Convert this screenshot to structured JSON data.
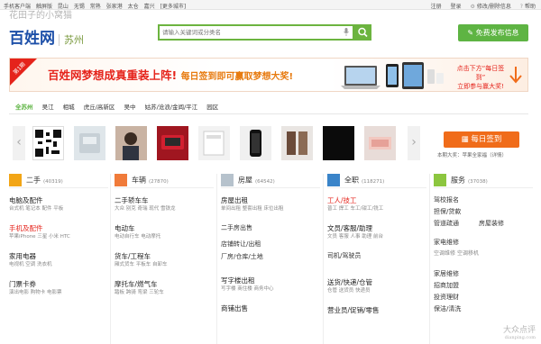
{
  "topbar": {
    "left": [
      "手机客户端",
      "触屏版",
      "昆山",
      "无锡",
      "常熟",
      "张家港",
      "太仓",
      "嘉兴",
      "[更多城市]"
    ],
    "right": [
      "注册",
      "登录",
      "修改/删除信息",
      "帮助"
    ]
  },
  "watermark_top": "花田子的小窝猫",
  "header": {
    "logo": "百姓网",
    "city": "苏州",
    "search_placeholder": "请输入关键词或分类名",
    "post_button": "免费发布信息"
  },
  "banner": {
    "badge": "第1期",
    "title": "百姓网梦想成真重装上阵!",
    "subtitle": "每日签到即可赢取梦想大奖!",
    "right_line1": "点击下方“每日签到”",
    "right_line2": "立即参与赢大奖!"
  },
  "districts": [
    "全苏州",
    "吴江",
    "相城",
    "虎丘/高新区",
    "吴中",
    "姑苏/沧浪/金阊/平江",
    "园区"
  ],
  "signin": {
    "button": "每日签到",
    "note": "本期大奖：苹果全家福（详情）"
  },
  "categories": [
    {
      "name": "二手",
      "count": "(40319)",
      "color": "#f2a516",
      "items": [
        {
          "title": "电脑及配件",
          "sub": "台式机 笔记本 配件 平板",
          "hl": false
        },
        {
          "title": "手机及配件",
          "sub": "苹果iPhone 三星 小米 HTC",
          "hl": true
        },
        {
          "title": "家用电器",
          "sub": "电视机 空调 洗衣机",
          "hl": false
        },
        {
          "title": "门票卡券",
          "sub": "演出电影 购物卡 电影票",
          "hl": false
        }
      ]
    },
    {
      "name": "车辆",
      "count": "(27870)",
      "color": "#f07b3a",
      "items": [
        {
          "title": "二手轿车车",
          "sub": "大众 别克 奇瑞 现代 雪铁龙",
          "hl": false
        },
        {
          "title": "电动车",
          "sub": "电动自行车 电动摩托",
          "hl": false
        },
        {
          "title": "货车/工程车",
          "sub": "厢式货车 平板车 自卸车",
          "hl": false
        },
        {
          "title": "摩托车/燃气车",
          "sub": "踏板 跨骑 弯梁 三轮车",
          "hl": false
        }
      ]
    },
    {
      "name": "房屋",
      "count": "(64542)",
      "color": "#b6c2cc",
      "items": [
        "房屋出租",
        "单间出租 整套出租 床位出租",
        "二手房出售",
        "店铺转让/出租",
        "厂房/仓库/土地",
        "写字楼出租",
        "写字楼 商住楼 商务中心",
        "商铺出售"
      ]
    },
    {
      "name": "全职",
      "count": "(118271)",
      "color": "#3a84c9",
      "items": [
        "工人/技工",
        "普工 焊工 车工/钳工/铣工",
        "文员/客服/助理",
        "文员 客服 人事 助理 前台",
        "司机/驾驶员",
        "送货/快递/仓管",
        "仓管 送货员 快递员",
        "营业员/促销/零售"
      ]
    },
    {
      "name": "服务",
      "count": "(37038)",
      "color": "#8cc63f",
      "items": [
        "驾校报名",
        "担保/贷款",
        "管道疏通",
        "房屋装修",
        "家电维修",
        "空调维修",
        "空调移机",
        "家居维修",
        "招商加盟",
        "投资理财",
        "保洁/清洗"
      ]
    }
  ],
  "watermark_bottom": {
    "title": "大众点评",
    "url": "dianping.com"
  },
  "colors": {
    "green": "#5eb443",
    "orange": "#f06c1a",
    "red": "#e5231b",
    "blue": "#1c4fa8"
  }
}
